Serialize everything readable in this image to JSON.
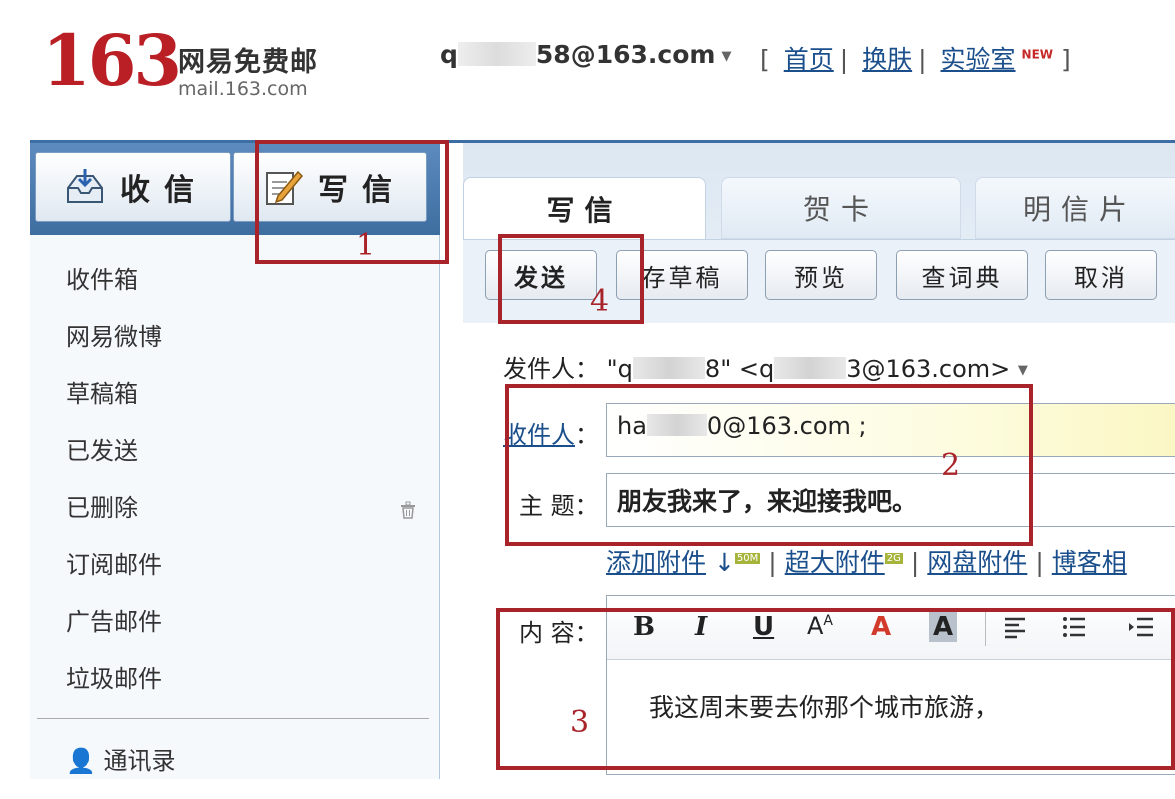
{
  "brand": {
    "number": "163",
    "name": "网易免费邮",
    "domain": "mail.163.com"
  },
  "account": {
    "email_prefix": "q",
    "email_suffix": "58@163.com"
  },
  "top_links": {
    "home": "首页",
    "skin": "换肤",
    "lab": "实验室",
    "lab_badge": "NEW"
  },
  "sidebar": {
    "receive_label": "收信",
    "compose_label": "写信",
    "folders": [
      "收件箱",
      "网易微博",
      "草稿箱",
      "已发送",
      "已删除",
      "订阅邮件",
      "广告邮件",
      "垃圾邮件"
    ],
    "contacts_label": "通讯录"
  },
  "tabs": [
    "写信",
    "贺卡",
    "明信片"
  ],
  "toolbar": {
    "send": "发送",
    "save_draft": "存草稿",
    "preview": "预览",
    "dictionary": "查词典",
    "cancel": "取消"
  },
  "compose": {
    "from_label": "发件人：",
    "from_name_start": "\"q",
    "from_name_end": "8\" <q",
    "from_email_end": "3@163.com>",
    "to_label": "收件人",
    "to_colon": "：",
    "to_value_start": "ha",
    "to_value_end": "0@163.com ;",
    "subject_label": "主 题：",
    "subject_value": "朋友我来了，来迎接我吧。",
    "content_label": "内 容：",
    "body_text": "我这周末要去你那个城市旅游，"
  },
  "attachments": {
    "add": "添加附件",
    "add_badge": "50M",
    "large": "超大附件",
    "large_badge": "2G",
    "netdisk": "网盘附件",
    "blog": "博客相"
  },
  "editor_toolbar": {
    "bold": "B",
    "italic": "I",
    "underline": "U",
    "font_size": "A",
    "font_size_sup": "A",
    "font_color": "A",
    "bg_color": "A"
  },
  "annotations": [
    "1",
    "2",
    "3",
    "4"
  ],
  "colors": {
    "brand_red": "#b91f24",
    "annotation_red": "#a8232a",
    "link_blue": "#1a4f8c",
    "sidebar_blue": "#3e6da0"
  }
}
